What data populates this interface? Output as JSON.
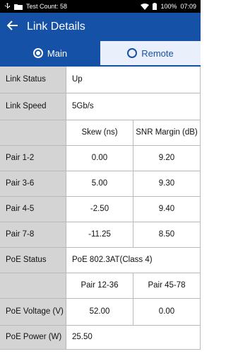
{
  "status_bar": {
    "left_text": "Test Count: 58",
    "battery": "100%",
    "time": "07:09"
  },
  "app_bar": {
    "title": "Link Details"
  },
  "tabs": [
    {
      "label": "Main",
      "selected": true
    },
    {
      "label": "Remote",
      "selected": false
    }
  ],
  "details": {
    "link_status": {
      "label": "Link Status",
      "value": "Up"
    },
    "link_speed": {
      "label": "Link Speed",
      "value": "5Gb/s"
    },
    "pair_headers": {
      "skew": "Skew (ns)",
      "snr": "SNR Margin (dB)"
    },
    "pairs": [
      {
        "label": "Pair 1-2",
        "skew": "0.00",
        "snr": "9.20"
      },
      {
        "label": "Pair 3-6",
        "skew": "5.00",
        "snr": "9.30"
      },
      {
        "label": "Pair 4-5",
        "skew": "-2.50",
        "snr": "9.40"
      },
      {
        "label": "Pair 7-8",
        "skew": "-11.25",
        "snr": "8.50"
      }
    ],
    "poe_status": {
      "label": "PoE Status",
      "value": "PoE 802.3AT(Class 4)"
    },
    "poe_headers": {
      "a": "Pair 12-36",
      "b": "Pair 45-78"
    },
    "poe_voltage": {
      "label": "PoE Voltage (V)",
      "a": "52.00",
      "b": "0.00"
    },
    "poe_power": {
      "label": "PoE Power (W)",
      "value": "25.50"
    }
  },
  "colors": {
    "primary": "#1651a8",
    "label_bg": "#d4d4d4",
    "tab_inactive_bg": "#eaf0fb"
  }
}
